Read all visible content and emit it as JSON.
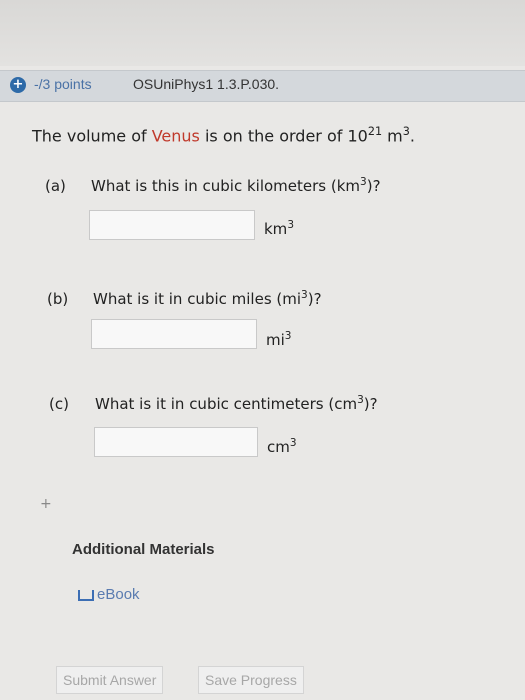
{
  "header": {
    "points": "-/3 points",
    "problem_id": "OSUniPhys1 1.3.P.030."
  },
  "question": {
    "prefix": "The volume of ",
    "planet": "Venus",
    "middle": " is on the order of 10",
    "exponent": "21",
    "unit_base": " m",
    "unit_exp": "3",
    "suffix": "."
  },
  "parts": [
    {
      "letter": "(a)",
      "prompt": "What is this in cubic kilometers (km",
      "exp": "3",
      "close": ")?",
      "unit": "km",
      "unit_exp": "3",
      "value": ""
    },
    {
      "letter": "(b)",
      "prompt": "What is it in cubic miles (mi",
      "exp": "3",
      "close": ")?",
      "unit": "mi",
      "unit_exp": "3",
      "value": ""
    },
    {
      "letter": "(c)",
      "prompt": "What is it in cubic centimeters (cm",
      "exp": "3",
      "close": ")?",
      "unit": "cm",
      "unit_exp": "3",
      "value": ""
    }
  ],
  "additional": {
    "toggle": "+",
    "title": "Additional Materials",
    "ebook": "eBook"
  },
  "buttons": {
    "submit": "Submit Answer",
    "save": "Save Progress"
  },
  "colors": {
    "accent": "#2d6aa8",
    "venus": "#c0392b",
    "link": "#5a7bb0"
  }
}
